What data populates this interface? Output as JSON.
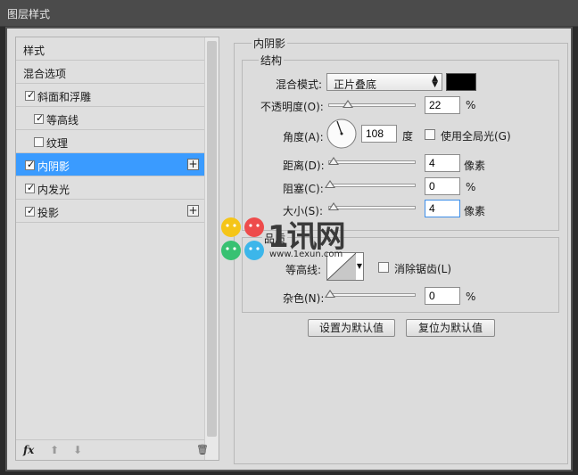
{
  "window": {
    "title": "图层样式"
  },
  "style_list": {
    "items": [
      {
        "label": "样式",
        "checkbox": false,
        "plus": false,
        "selected": false
      },
      {
        "label": "混合选项",
        "checkbox": false,
        "plus": false,
        "selected": false
      },
      {
        "label": "斜面和浮雕",
        "checkbox": true,
        "checked": true,
        "plus": false,
        "selected": false
      },
      {
        "label": "等高线",
        "checkbox": true,
        "checked": true,
        "plus": false,
        "selected": false,
        "indent": true
      },
      {
        "label": "纹理",
        "checkbox": true,
        "checked": false,
        "plus": false,
        "selected": false,
        "indent": true
      },
      {
        "label": "内阴影",
        "checkbox": true,
        "checked": true,
        "plus": true,
        "selected": true
      },
      {
        "label": "内发光",
        "checkbox": true,
        "checked": true,
        "plus": false,
        "selected": false
      },
      {
        "label": "投影",
        "checkbox": true,
        "checked": true,
        "plus": true,
        "selected": false
      }
    ],
    "toolbar": {
      "fx": "fx",
      "up": "⬆",
      "down": "⬇",
      "trash": "🗑"
    },
    "check_mark": "☑",
    "plus_glyph": "+"
  },
  "inner_shadow": {
    "section_title": "内阴影",
    "structure": {
      "title": "结构",
      "blend_mode_label": "混合模式:",
      "blend_mode_value": "正片叠底",
      "blend_color": "#000000",
      "opacity_label": "不透明度(O):",
      "opacity_value": "22",
      "opacity_unit": "%",
      "opacity_level": 0.22,
      "angle_label": "角度(A):",
      "angle_value": "108",
      "angle_unit": "度",
      "global_light_label": "使用全局光(G)",
      "distance_label": "距离(D):",
      "distance_value": "4",
      "distance_unit": "像素",
      "choke_label": "阻塞(C):",
      "choke_value": "0",
      "choke_unit": "%",
      "size_label": "大小(S):",
      "size_value": "4",
      "size_unit": "像素"
    },
    "quality": {
      "title": "品质",
      "contour_label": "等高线:",
      "antialias_label": "消除锯齿(L)",
      "noise_label": "杂色(N):",
      "noise_value": "0",
      "noise_unit": "%"
    },
    "buttons": {
      "set_default": "设置为默认值",
      "reset_default": "复位为默认值"
    }
  },
  "watermark": {
    "brand": "1讯网",
    "url": "www.1exun.com"
  }
}
